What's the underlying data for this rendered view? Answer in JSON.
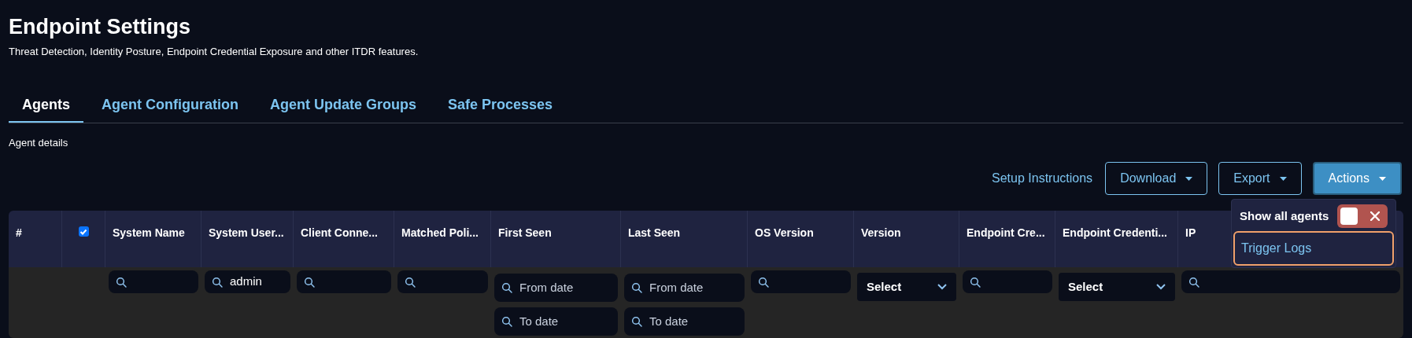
{
  "page": {
    "title": "Endpoint Settings",
    "subtitle": "Threat Detection, Identity Posture, Endpoint Credential Exposure and other ITDR features."
  },
  "tabs": [
    {
      "label": "Agents",
      "selected": true
    },
    {
      "label": "Agent Configuration",
      "selected": false
    },
    {
      "label": "Agent Update Groups",
      "selected": false
    },
    {
      "label": "Safe Processes",
      "selected": false
    }
  ],
  "section_label": "Agent details",
  "toolbar": {
    "link": "Setup Instructions",
    "buttons": [
      {
        "label": "Download",
        "selected": false
      },
      {
        "label": "Export",
        "selected": false
      },
      {
        "label": "Actions",
        "selected": true
      }
    ]
  },
  "actions_menu": {
    "toggle": {
      "label": "Show all agents",
      "on": false
    },
    "items": [
      {
        "label": "Trigger Logs",
        "selected": true
      }
    ]
  },
  "table": {
    "columns": [
      {
        "kind": "text",
        "label": "#"
      },
      {
        "kind": "checkbox",
        "checked": true
      },
      {
        "kind": "text",
        "label": "System Name"
      },
      {
        "kind": "text",
        "label": "System User..."
      },
      {
        "kind": "text",
        "label": "Client Conne..."
      },
      {
        "kind": "text",
        "label": "Matched Poli..."
      },
      {
        "kind": "text",
        "label": "First Seen"
      },
      {
        "kind": "text",
        "label": "Last Seen"
      },
      {
        "kind": "text",
        "label": "OS Version"
      },
      {
        "kind": "text",
        "label": "Version"
      },
      {
        "kind": "text",
        "label": "Endpoint Cre..."
      },
      {
        "kind": "text",
        "label": "Endpoint Credenti..."
      },
      {
        "kind": "text",
        "label": "IP"
      }
    ],
    "filters": [
      {
        "kind": "none"
      },
      {
        "kind": "none"
      },
      {
        "kind": "search"
      },
      {
        "kind": "search",
        "value": "admin"
      },
      {
        "kind": "search"
      },
      {
        "kind": "search"
      },
      {
        "kind": "date_range",
        "from": "From date",
        "to": "To date"
      },
      {
        "kind": "date_range",
        "from": "From date",
        "to": "To date"
      },
      {
        "kind": "search"
      },
      {
        "kind": "select",
        "value": "Select"
      },
      {
        "kind": "search"
      },
      {
        "kind": "select",
        "value": "Select"
      },
      {
        "kind": "search"
      }
    ]
  }
}
